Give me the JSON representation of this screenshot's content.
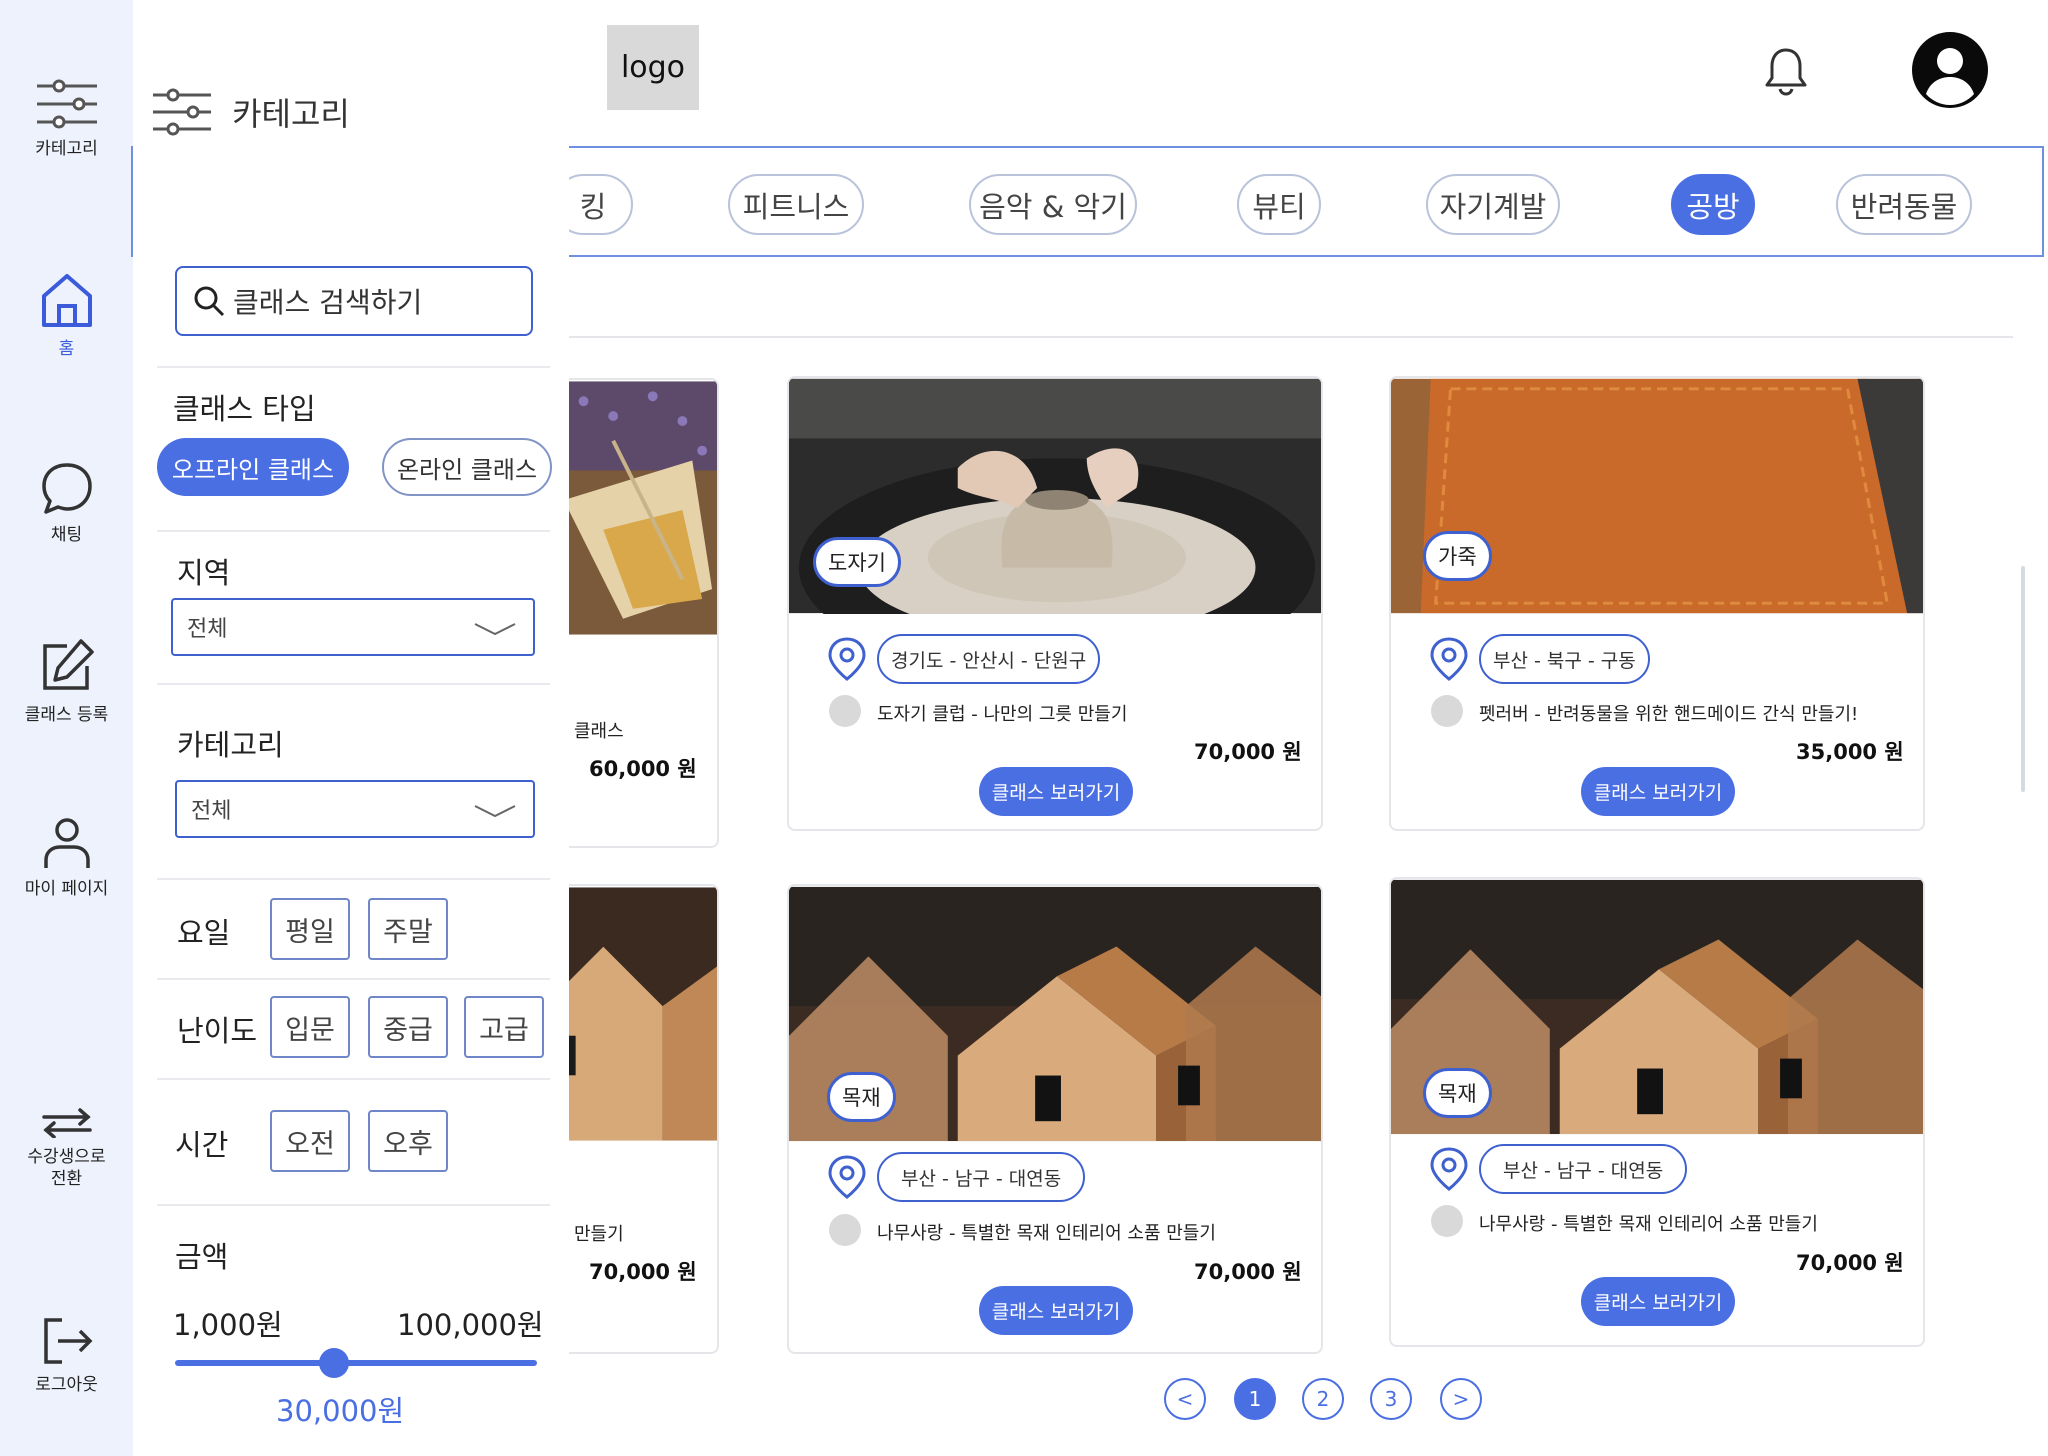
{
  "rail": {
    "items": [
      {
        "label": "카테고리",
        "icon": "sliders-icon"
      },
      {
        "label": "홈",
        "icon": "home-icon"
      },
      {
        "label": "채팅",
        "icon": "chat-icon"
      },
      {
        "label": "클래스 등록",
        "icon": "edit-icon"
      },
      {
        "label": "마이 페이지",
        "icon": "user-icon"
      },
      {
        "label": "수강생으로\n전환",
        "icon": "swap-icon"
      },
      {
        "label": "로그아웃",
        "icon": "logout-icon"
      }
    ],
    "active_color": "#3b5bdb",
    "background": "#edf2fc"
  },
  "header": {
    "logo": "logo",
    "notification_icon": "bell-icon",
    "profile_icon": "avatar-icon"
  },
  "category_strip": {
    "chips": [
      {
        "label": "킹",
        "selected": false
      },
      {
        "label": "피트니스",
        "selected": false
      },
      {
        "label": "음악 & 악기",
        "selected": false
      },
      {
        "label": "뷰티",
        "selected": false
      },
      {
        "label": "자기계발",
        "selected": false
      },
      {
        "label": "공방",
        "selected": true
      },
      {
        "label": "반려동물",
        "selected": false
      }
    ],
    "accent": "#4a6fe3"
  },
  "filter_panel": {
    "title": "카테고리",
    "search_placeholder": "클래스 검색하기",
    "class_type": {
      "title": "클래스 타입",
      "options": [
        {
          "label": "오프라인 클래스",
          "selected": true
        },
        {
          "label": "온라인 클래스",
          "selected": false
        }
      ]
    },
    "region": {
      "title": "지역",
      "value": "전체"
    },
    "category": {
      "title": "카테고리",
      "value": "전체"
    },
    "day": {
      "title": "요일",
      "options": [
        "평일",
        "주말"
      ]
    },
    "level": {
      "title": "난이도",
      "options": [
        "입문",
        "중급",
        "고급"
      ]
    },
    "time": {
      "title": "시간",
      "options": [
        "오전",
        "오후"
      ]
    },
    "price": {
      "title": "금액",
      "min_label": "1,000원",
      "max_label": "100,000원",
      "value_label": "30,000원",
      "min": 1000,
      "max": 100000,
      "value": 30000
    }
  },
  "cards": [
    {
      "partial": true,
      "title": "클래스",
      "price": "60,000 원"
    },
    {
      "tag": "도자기",
      "location": "경기도 -  안산시 - 단원구",
      "title": "도자기 클럽 -  나만의 그릇 만들기",
      "price": "70,000 원",
      "button": "클래스 보러가기"
    },
    {
      "tag": "가죽",
      "location": "부산 - 북구 - 구동",
      "title": "펫러버  - 반려동물을 위한 핸드메이드 간식 만들기!",
      "price": "35,000 원",
      "button": "클래스 보러가기"
    },
    {
      "partial": true,
      "title": "만들기",
      "price": "70,000 원"
    },
    {
      "tag": "목재",
      "location": "부산 -  남구 - 대연동",
      "title": "나무사랑  -  특별한 목재 인테리어 소품 만들기",
      "price": "70,000 원",
      "button": "클래스 보러가기"
    },
    {
      "tag": "목재",
      "location": "부산 -  남구 - 대연동",
      "title": "나무사랑  -  특별한 목재 인테리어 소품 만들기",
      "price": "70,000 원",
      "button": "클래스 보러가기"
    }
  ],
  "pagination": {
    "prev": "<",
    "pages": [
      "1",
      "2",
      "3"
    ],
    "current": "1",
    "next": ">"
  }
}
